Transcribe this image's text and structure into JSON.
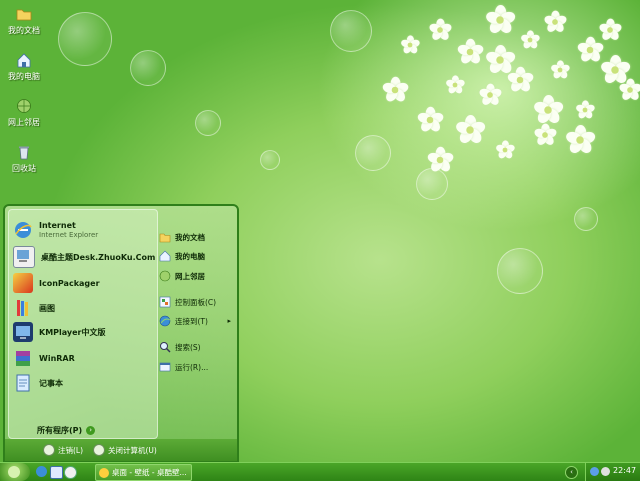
{
  "desktop_icons": [
    {
      "label": "我的文档",
      "icon": "folder-icon"
    },
    {
      "label": "我的电脑",
      "icon": "computer-icon"
    },
    {
      "label": "网上邻居",
      "icon": "network-icon"
    },
    {
      "label": "回收站",
      "icon": "recycle-bin-icon"
    }
  ],
  "start_menu": {
    "left_items": [
      {
        "label": "Internet",
        "sublabel": "Internet Explorer",
        "icon": "internet-explorer-icon"
      },
      {
        "label": "桌酷主题Desk.ZhuoKu.Com",
        "icon": "theme-icon"
      },
      {
        "label": "IconPackager",
        "icon": "iconpackager-icon"
      },
      {
        "label": "画图",
        "icon": "paint-icon"
      },
      {
        "label": "KMPlayer中文版",
        "icon": "kmplayer-icon"
      },
      {
        "label": "WinRAR",
        "icon": "winrar-icon"
      },
      {
        "label": "记事本",
        "icon": "notepad-icon"
      }
    ],
    "all_programs": "所有程序(P)",
    "right_items": [
      {
        "label": "我的文档",
        "icon": "folder-icon"
      },
      {
        "label": "我的电脑",
        "icon": "computer-icon"
      },
      {
        "label": "网上邻居",
        "icon": "network-icon"
      },
      {
        "label": "控制面板(C)",
        "icon": "control-panel-icon"
      },
      {
        "label": "连接到(T)",
        "icon": "connect-icon",
        "has_submenu": true
      },
      {
        "label": "搜索(S)",
        "icon": "search-icon"
      },
      {
        "label": "运行(R)...",
        "icon": "run-icon"
      }
    ],
    "logoff": "注销(L)",
    "shutdown": "关闭计算机(U)"
  },
  "taskbar": {
    "window_title": "桌面 - 壁纸 - 桌酷壁...",
    "clock": "22:47"
  },
  "colors": {
    "menu_border": "#2f7f1a",
    "taskbar": "#3c9420"
  }
}
